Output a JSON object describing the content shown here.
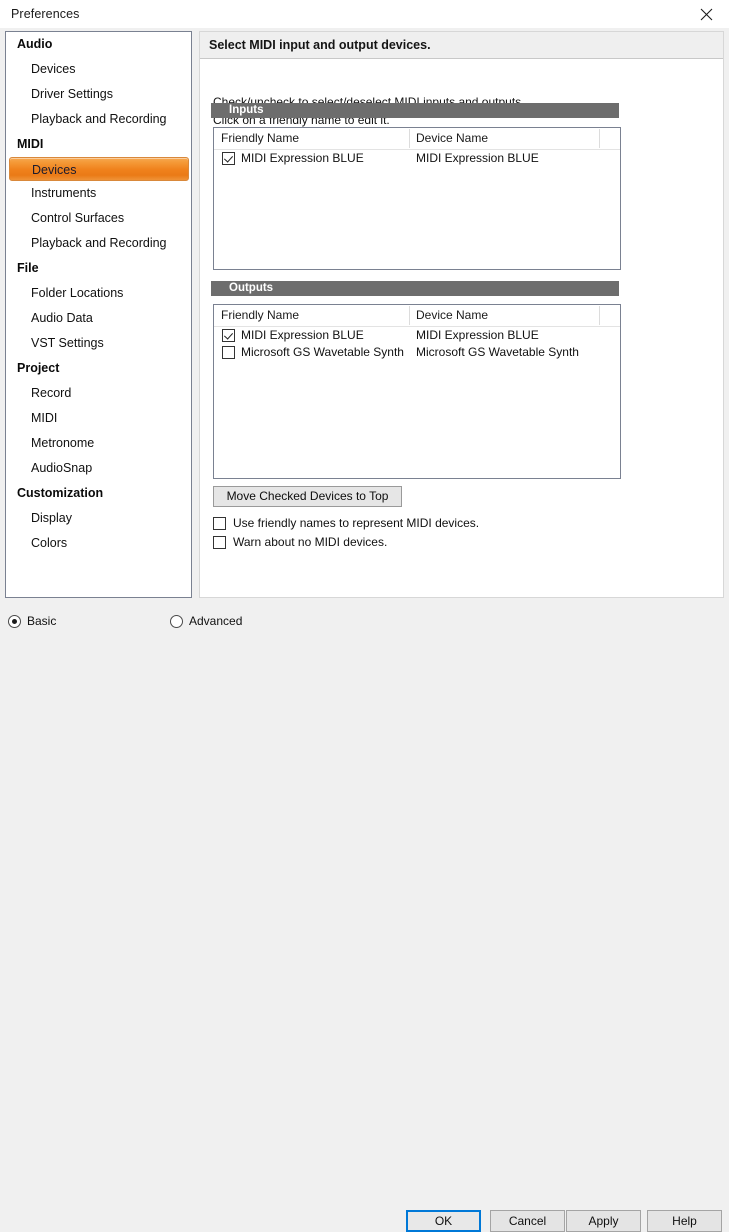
{
  "window": {
    "title": "Preferences",
    "close_icon": "close-icon"
  },
  "sidebar": {
    "groups": [
      {
        "label": "Audio",
        "items": [
          {
            "label": "Devices",
            "selected": false
          },
          {
            "label": "Driver Settings",
            "selected": false
          },
          {
            "label": "Playback and Recording",
            "selected": false
          }
        ]
      },
      {
        "label": "MIDI",
        "items": [
          {
            "label": "Devices",
            "selected": true
          },
          {
            "label": "Instruments",
            "selected": false
          },
          {
            "label": "Control Surfaces",
            "selected": false
          },
          {
            "label": "Playback and Recording",
            "selected": false
          }
        ]
      },
      {
        "label": "File",
        "items": [
          {
            "label": "Folder Locations",
            "selected": false
          },
          {
            "label": "Audio Data",
            "selected": false
          },
          {
            "label": "VST Settings",
            "selected": false
          }
        ]
      },
      {
        "label": "Project",
        "items": [
          {
            "label": "Record",
            "selected": false
          },
          {
            "label": "MIDI",
            "selected": false
          },
          {
            "label": "Metronome",
            "selected": false
          },
          {
            "label": "AudioSnap",
            "selected": false
          }
        ]
      },
      {
        "label": "Customization",
        "items": [
          {
            "label": "Display",
            "selected": false
          },
          {
            "label": "Colors",
            "selected": false
          }
        ]
      }
    ]
  },
  "main": {
    "header": "Select MIDI input and output devices.",
    "description_line1": "Check/uncheck to select/deselect MIDI inputs and outputs.",
    "description_line2": "Click on a friendly name to edit it.",
    "inputs": {
      "section_title": "Inputs",
      "columns": [
        "Friendly Name",
        "Device Name"
      ],
      "rows": [
        {
          "checked": true,
          "friendly_name": "MIDI Expression BLUE",
          "device_name": "MIDI Expression BLUE"
        }
      ]
    },
    "outputs": {
      "section_title": "Outputs",
      "columns": [
        "Friendly Name",
        "Device Name"
      ],
      "rows": [
        {
          "checked": true,
          "friendly_name": "MIDI Expression BLUE",
          "device_name": "MIDI Expression BLUE"
        },
        {
          "checked": false,
          "friendly_name": "Microsoft GS Wavetable Synth",
          "device_name": "Microsoft GS Wavetable Synth"
        }
      ]
    },
    "move_button": "Move Checked Devices to Top",
    "options": [
      {
        "label": "Use friendly names to represent MIDI devices.",
        "checked": false
      },
      {
        "label": "Warn about no MIDI devices.",
        "checked": false
      }
    ]
  },
  "footer": {
    "modes": [
      {
        "label": "Basic",
        "selected": true
      },
      {
        "label": "Advanced",
        "selected": false
      }
    ],
    "buttons": [
      {
        "label": "OK",
        "primary": true
      },
      {
        "label": "Cancel",
        "primary": false
      },
      {
        "label": "Apply",
        "primary": false
      },
      {
        "label": "Help",
        "primary": false
      }
    ]
  },
  "colors": {
    "accent_selected": "#f0821c",
    "section_bar": "#6d6d6d",
    "focus_border": "#0078d7"
  }
}
